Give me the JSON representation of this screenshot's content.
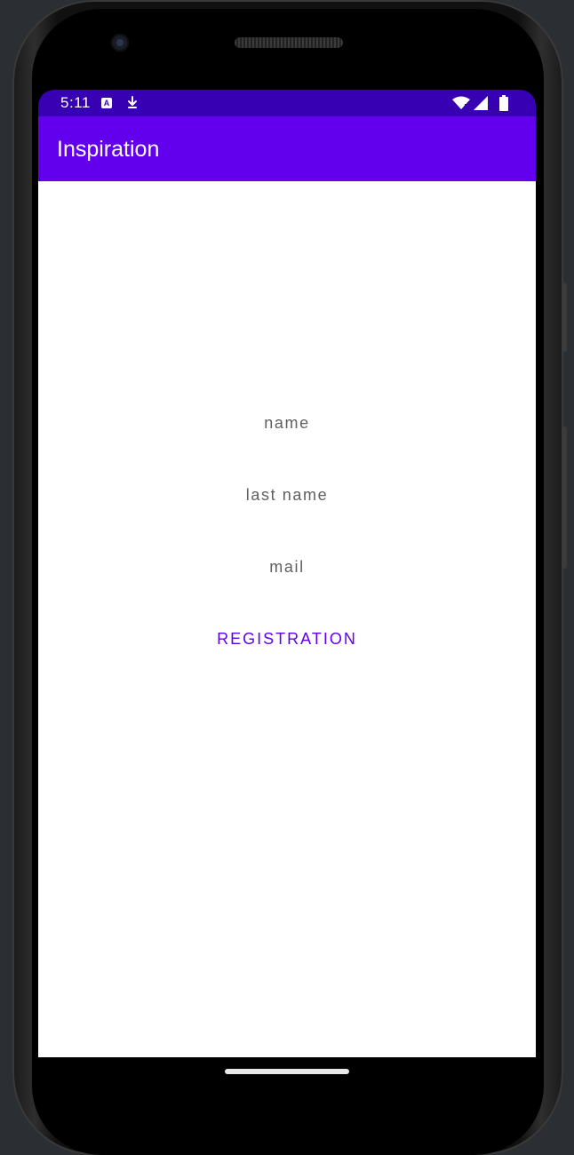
{
  "device": {
    "frame_color": "#111111",
    "icons": [
      "front-camera-icon",
      "speaker-grille-icon"
    ]
  },
  "status_bar": {
    "time": "5:11",
    "background": "#3700b3",
    "icons": [
      "notification-a-icon",
      "download-icon",
      "wifi-icon",
      "signal-icon",
      "battery-icon"
    ]
  },
  "app_bar": {
    "title": "Inspiration",
    "background": "#6200ee"
  },
  "form": {
    "name_label": "name",
    "last_name_label": "last name",
    "mail_label": "mail",
    "registration_button": "REGISTRATION",
    "accent": "#6200ee"
  },
  "nav_bar": {
    "icons": [
      "home-pill-icon"
    ]
  }
}
